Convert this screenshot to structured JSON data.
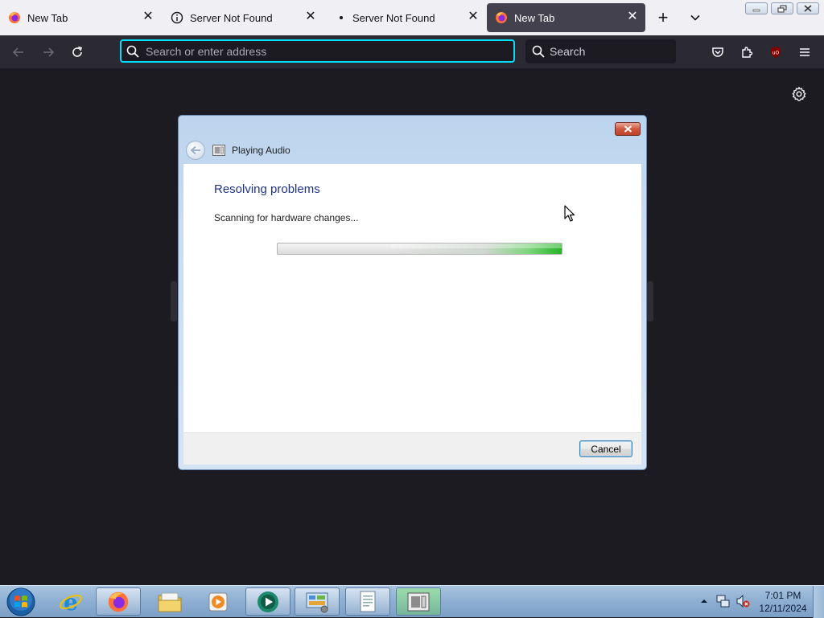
{
  "browser": {
    "tabs": [
      {
        "title": "New Tab",
        "icon": "firefox-icon",
        "active": false
      },
      {
        "title": "Server Not Found",
        "icon": "info-icon",
        "active": false
      },
      {
        "title": "Server Not Found",
        "icon": "dot-icon",
        "active": false
      },
      {
        "title": "New Tab",
        "icon": "firefox-icon",
        "active": true
      }
    ],
    "close_glyph": "✕",
    "new_tab_glyph": "+",
    "urlbar": {
      "placeholder": "Search or enter address",
      "value": ""
    },
    "searchbar": {
      "placeholder": "Search",
      "value": ""
    },
    "accent_color": "#00ddff"
  },
  "dialog": {
    "title": "Playing Audio",
    "heading": "Resolving problems",
    "status": "Scanning for hardware changes...",
    "progress": 0.6,
    "cancel_label": "Cancel"
  },
  "taskbar": {
    "items": [
      {
        "name": "internet-explorer-icon",
        "open": false
      },
      {
        "name": "firefox-icon",
        "open": true
      },
      {
        "name": "file-explorer-icon",
        "open": false
      },
      {
        "name": "media-player-icon",
        "open": false
      },
      {
        "name": "media-center-icon",
        "open": true
      },
      {
        "name": "control-panel-icon",
        "open": true
      },
      {
        "name": "notepad-document-icon",
        "open": true
      },
      {
        "name": "troubleshooter-icon",
        "open": true
      }
    ],
    "clock": {
      "time": "7:01 PM",
      "date": "12/11/2024"
    }
  }
}
